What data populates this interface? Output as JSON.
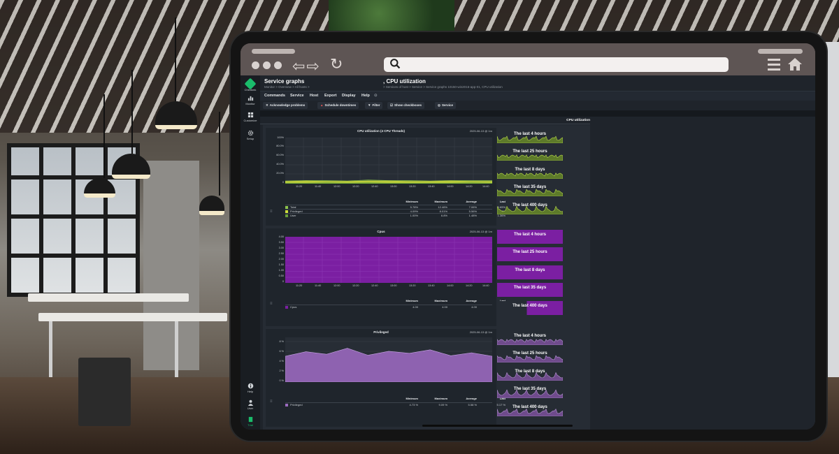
{
  "app": {
    "title": "Service graphs",
    "subtitle": ", CPU utilization",
    "breadcrumb_left": "Monitor > Overview > All hosts >",
    "breadcrumb_right": "> Services of host > Service > Service graphs 10150-win2016-app-01, CPU utilization",
    "section_title": "CPU utilization"
  },
  "nav": {
    "logo_label": "Checkmk",
    "monitor": "Monitor",
    "customize": "Customize",
    "setup": "Setup",
    "help": "Help",
    "user": "User",
    "trial": "Trial",
    "accent": "#1abc6b"
  },
  "menubar": [
    "Commands",
    "Service",
    "Host",
    "Export",
    "Display",
    "Help"
  ],
  "toolbar": {
    "acknowledge": "Acknowledge problems",
    "schedule": "Schedule downtimes",
    "filter": "Filter",
    "checkboxes": "Show checkboxes",
    "service": "Service"
  },
  "time_ranges": [
    "The last 4 hours",
    "The last 25 hours",
    "The last 8 days",
    "The last 35 days",
    "The last 400 days"
  ],
  "legend_headers": [
    "Minimum",
    "Maximum",
    "Average",
    "Last"
  ],
  "graph1": {
    "title": "CPU utilization (4 CPU Threads)",
    "date": "2025-06-13 @ 1m",
    "yticks": [
      "100%",
      "80.0%",
      "60.0%",
      "40.0%",
      "20.0%",
      "0"
    ],
    "xticks": [
      "11:20",
      "11:40",
      "12:00",
      "12:20",
      "12:40",
      "13:00",
      "13:20",
      "13:40",
      "14:00",
      "14:20",
      "14:40"
    ],
    "rows": [
      {
        "name": "Total",
        "color": "#8bc34a",
        "min": "5.78%",
        "max": "12.46%",
        "avg": "7.06%",
        "last": "6.65%"
      },
      {
        "name": "Privileged",
        "color": "#cddc39",
        "min": "4.09%",
        "max": "8.01%",
        "avg": "5.56%",
        "last": "5.16%"
      },
      {
        "name": "User",
        "color": "#689f38",
        "min": "1.00%",
        "max": "6.8%",
        "avg": "1.48%",
        "last": "1.36%"
      }
    ]
  },
  "graph2": {
    "title": "Cpus",
    "date": "2025-06-13 @ 1m",
    "yticks": [
      "4.00",
      "3.50",
      "3.00",
      "2.50",
      "2.00",
      "1.50",
      "1.00",
      "0.50",
      "0"
    ],
    "xticks": [
      "11:20",
      "11:40",
      "12:00",
      "12:20",
      "12:40",
      "13:00",
      "13:20",
      "13:40",
      "14:00",
      "14:20",
      "14:40"
    ],
    "rows": [
      {
        "name": "Cpus",
        "color": "#7b1fa2",
        "min": "4.00",
        "max": "4.00",
        "avg": "4.00",
        "last": "4.00"
      }
    ]
  },
  "graph3": {
    "title": "Privileged",
    "date": "2025-06-13 @ 1m",
    "yticks": [
      "8 %",
      "6 %",
      "4 %",
      "2 %",
      "0 %"
    ],
    "xticks": [
      "11:20",
      "11:40",
      "12:00",
      "12:20",
      "12:40",
      "13:00",
      "13:20",
      "13:40",
      "14:00",
      "14:20",
      "14:40"
    ],
    "rows": [
      {
        "name": "Privileged",
        "color": "#9c6bbf",
        "min": "4.73 %",
        "max": "9.09 %",
        "avg": "5.58 %",
        "last": "5.17 %"
      }
    ]
  },
  "chart_data": [
    {
      "type": "area",
      "title": "CPU utilization (4 CPU Threads)",
      "x": [
        "11:20",
        "11:40",
        "12:00",
        "12:20",
        "12:40",
        "13:00",
        "13:20",
        "13:40",
        "14:00",
        "14:20",
        "14:40"
      ],
      "ylim": [
        0,
        100
      ],
      "series": [
        {
          "name": "Total",
          "values": [
            6,
            7,
            7,
            6,
            8,
            7,
            7,
            6,
            7,
            7,
            7
          ]
        },
        {
          "name": "Privileged",
          "values": [
            5,
            6,
            5,
            5,
            6,
            6,
            5,
            5,
            6,
            5,
            5
          ]
        },
        {
          "name": "User",
          "values": [
            1,
            1,
            2,
            1,
            2,
            1,
            1,
            1,
            1,
            2,
            1
          ]
        }
      ]
    },
    {
      "type": "area",
      "title": "Cpus",
      "x": [
        "11:20",
        "11:40",
        "12:00",
        "12:20",
        "12:40",
        "13:00",
        "13:20",
        "13:40",
        "14:00",
        "14:20",
        "14:40"
      ],
      "ylim": [
        0,
        4
      ],
      "series": [
        {
          "name": "Cpus",
          "values": [
            4,
            4,
            4,
            4,
            4,
            4,
            4,
            4,
            4,
            4,
            4
          ]
        }
      ]
    },
    {
      "type": "area",
      "title": "Privileged",
      "x": [
        "11:20",
        "11:40",
        "12:00",
        "12:20",
        "12:40",
        "13:00",
        "13:20",
        "13:40",
        "14:00",
        "14:20",
        "14:40"
      ],
      "ylim": [
        0,
        9
      ],
      "series": [
        {
          "name": "Privileged",
          "values": [
            5.2,
            6.1,
            5.6,
            6.8,
            5.4,
            6.2,
            5.8,
            6.5,
            5.3,
            5.9,
            5.2
          ]
        }
      ]
    }
  ]
}
